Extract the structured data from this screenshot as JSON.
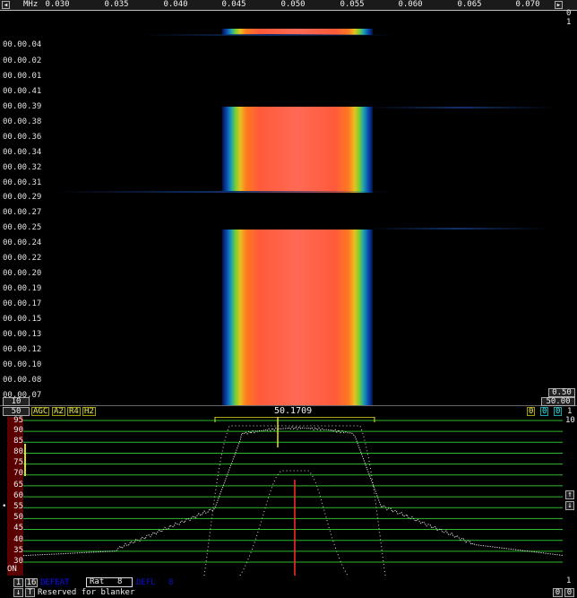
{
  "top_bar": {
    "left_arrow": "◂",
    "unit": "MHz",
    "freq_labels": [
      "0.030",
      "0.035",
      "0.040",
      "0.045",
      "0.050",
      "0.055",
      "0.060",
      "0.065",
      "0.070"
    ],
    "right_arrow": "▸",
    "zoom_top": "0",
    "zoom_bottom": "1"
  },
  "waterfall": {
    "time_labels": [
      "00.00.04",
      "00.00.02",
      "00.00.01",
      "00.00.41",
      "00.00.39",
      "00.00.38",
      "00.00.36",
      "00.00.34",
      "00.00.32",
      "00.00.31",
      "00.00.29",
      "00.00.27",
      "00.00.25",
      "00.00.24",
      "00.00.22",
      "00.00.20",
      "00.00.19",
      "00.00.17",
      "00.00.15",
      "00.00.13",
      "00.00.12",
      "00.00.10",
      "00.00.08",
      "00.00.07"
    ],
    "scale_bottom_left": "10",
    "scale_right_top": "0.50",
    "scale_right_bottom": "50.00"
  },
  "control_bar": {
    "level": "50",
    "buttons": [
      "AGC",
      "A2",
      "R4",
      "H2"
    ],
    "center_freq": "50.1709",
    "right_values": [
      "0",
      "0",
      "0"
    ],
    "right_end": "1"
  },
  "spectrum": {
    "y_labels": [
      "95",
      "90",
      "85",
      "80",
      "75",
      "70",
      "65",
      "60",
      "55",
      "50",
      "45",
      "40",
      "35",
      "30"
    ],
    "on_label": "ON",
    "right_top": "10",
    "right_bottom": "1",
    "scroll_up": "↑",
    "scroll_down": "↓"
  },
  "bottom_bar": {
    "num_1": "1",
    "num_16": "16",
    "tag_1": "DEFEAT",
    "rat_label": "Rat",
    "rat_value": "8",
    "tag_2": "DEFL",
    "tag_2_value": "8",
    "down_arrow": "↓",
    "t_button": "T",
    "status_text": "Reserved for blanker",
    "right_num": "0",
    "right_top_num": "1",
    "right_btn": "0"
  },
  "colors": {
    "signal_red": "#ff5a3a",
    "grid_green": "#2db82d",
    "trace_white": "#e0e0e0",
    "marker_red": "#ff3030",
    "marker_yellow": "#e0e020",
    "ylabel_bg": "#8a1010"
  }
}
